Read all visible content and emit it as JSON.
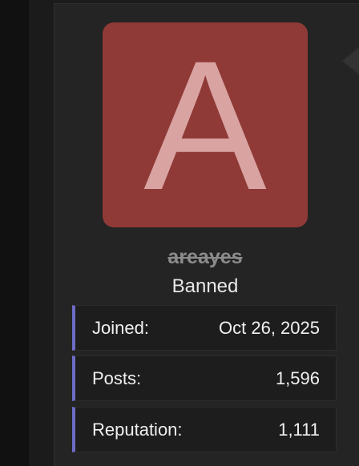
{
  "profile": {
    "avatar_letter": "A",
    "avatar_bg": "#8f3a37",
    "avatar_fg": "#d9a3a1",
    "username": "areayes",
    "user_title": "Banned",
    "stats": [
      {
        "label": "Joined:",
        "value": "Oct 26, 2025"
      },
      {
        "label": "Posts:",
        "value": "1,596"
      },
      {
        "label": "Reputation:",
        "value": "1,111"
      }
    ],
    "accent_color": "#6c6cc6"
  }
}
